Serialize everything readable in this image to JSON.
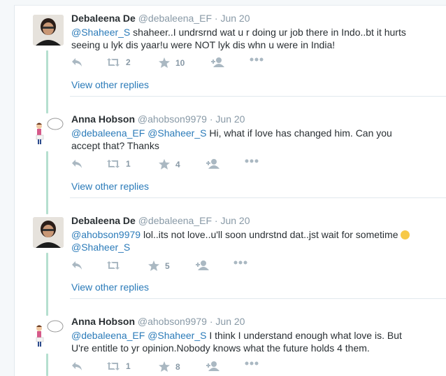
{
  "tweets": [
    {
      "fullname": "Debaleena De",
      "handle": "@debaleena_EF",
      "sep": "·",
      "date": "Jun 20",
      "mention": "@Shaheer_S",
      "body": " shaheer..I undrsrnd wat u r doing ur job there in Indo..bt it hurts seeing u lyk dis yaar!u were NOT lyk dis whn u were in India!",
      "retweets": "2",
      "favorites": "10",
      "view_replies": "View other replies"
    },
    {
      "fullname": "Anna Hobson",
      "handle": "@ahobson9979",
      "sep": "·",
      "date": "Jun 20",
      "mention1": "@debaleena_EF",
      "mention2": "@Shaheer_S",
      "body": " Hi, what if love has changed him. Can you accept that? Thanks",
      "retweets": "1",
      "favorites": "4",
      "view_replies": "View other replies"
    },
    {
      "fullname": "Debaleena De",
      "handle": "@debaleena_EF",
      "sep": "·",
      "date": "Jun 20",
      "mention1": "@ahobson9979",
      "body": " lol..its not love..u'll soon undrstnd dat..jst wait for sometime ",
      "emoji": "winking-face",
      "mention2": "@Shaheer_S",
      "retweets": "",
      "favorites": "5",
      "view_replies": "View other replies"
    },
    {
      "fullname": "Anna Hobson",
      "handle": "@ahobson9979",
      "sep": "·",
      "date": "Jun 20",
      "mention1": "@debaleena_EF",
      "mention2": "@Shaheer_S",
      "body": " I think I understand enough what love is. But U're entitle to yr opinion.Nobody knows what the future holds 4 them.",
      "retweets": "1",
      "favorites": "8"
    }
  ],
  "icons": {
    "reply": "reply-icon",
    "retweet": "retweet-icon",
    "favorite": "star-icon",
    "follow": "add-user-icon",
    "more": "more-dots-icon"
  },
  "colors": {
    "link": "#2b7bb9",
    "meta": "#8899a6",
    "thread_line": "#b5dfcf",
    "action_icon": "#aab8c2"
  }
}
